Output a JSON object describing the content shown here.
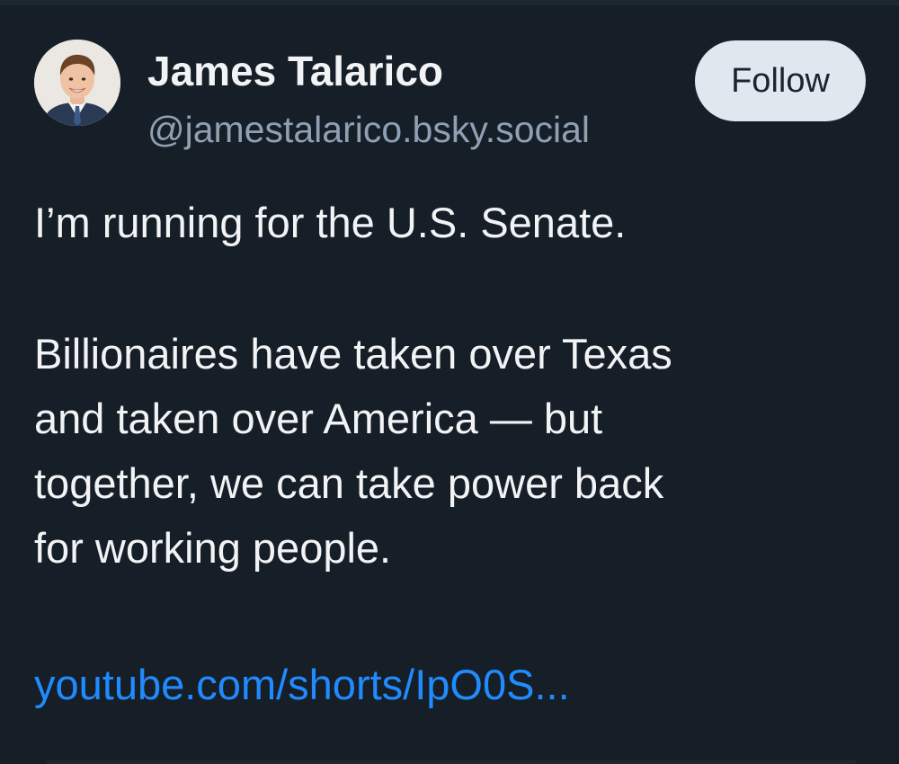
{
  "author": {
    "display_name": "James Talarico",
    "handle": "@jamestalarico.bsky.social",
    "avatar_icon": "profile-photo"
  },
  "actions": {
    "follow_label": "Follow"
  },
  "post": {
    "line_1": "I’m running for the U.S. Senate.",
    "paragraph_2_lines": [
      "Billionaires have taken over Texas",
      "and taken over America — but",
      "together, we can take power back",
      "for working people."
    ],
    "link_text": "youtube.com/shorts/IpO0S..."
  },
  "colors": {
    "background": "#161e27",
    "text": "#f1f3f5",
    "muted": "#8fa0b3",
    "link": "#208bfe",
    "button_bg": "#e1e7ee"
  }
}
